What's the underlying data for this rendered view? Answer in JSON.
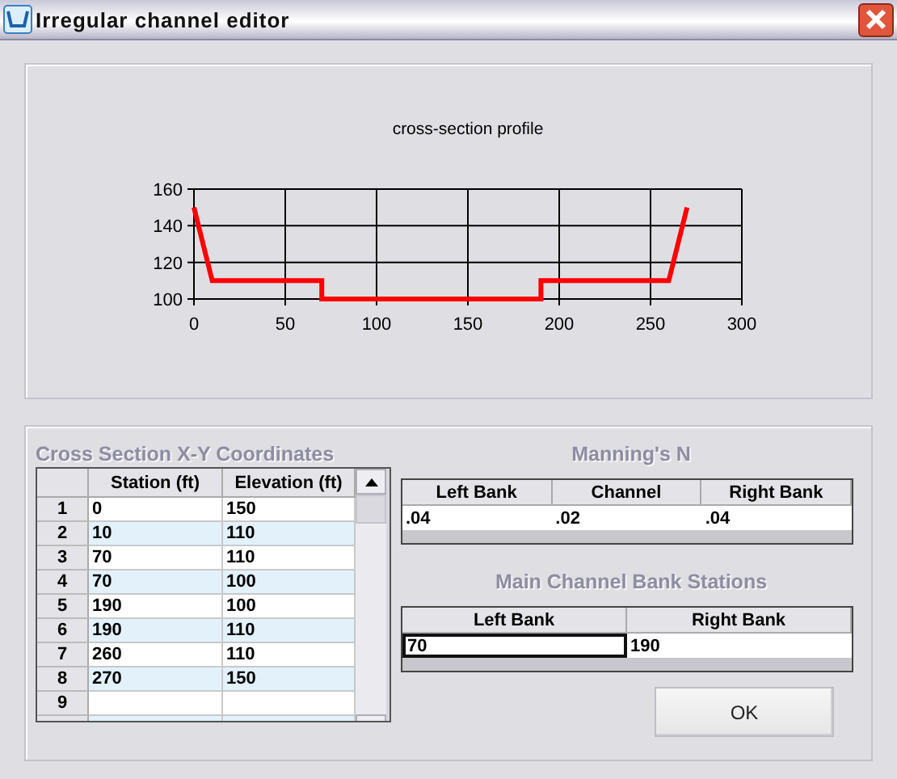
{
  "window": {
    "title": "Irregular channel editor"
  },
  "chart": {
    "chart_data": {
      "type": "line",
      "grid": true,
      "title": "cross-section profile",
      "x": [
        0,
        10,
        70,
        70,
        190,
        190,
        260,
        270
      ],
      "series": [
        {
          "color": "#ff0000",
          "values": [
            150,
            110,
            110,
            100,
            100,
            110,
            110,
            150
          ]
        }
      ],
      "xlim": [
        0,
        300
      ],
      "ylim": [
        100,
        160
      ],
      "xticks": [
        0,
        50,
        100,
        150,
        200,
        250,
        300
      ],
      "yticks": [
        100,
        120,
        140,
        160
      ]
    }
  },
  "coordinates": {
    "title": "Cross Section X-Y Coordinates",
    "columns": [
      "Station (ft)",
      "Elevation (ft)"
    ],
    "rows": [
      {
        "number": "1",
        "cells": [
          "0",
          "150"
        ]
      },
      {
        "number": "2",
        "cells": [
          "10",
          "110"
        ]
      },
      {
        "number": "3",
        "cells": [
          "70",
          "110"
        ]
      },
      {
        "number": "4",
        "cells": [
          "70",
          "100"
        ]
      },
      {
        "number": "5",
        "cells": [
          "190",
          "100"
        ]
      },
      {
        "number": "6",
        "cells": [
          "190",
          "110"
        ]
      },
      {
        "number": "7",
        "cells": [
          "260",
          "110"
        ]
      },
      {
        "number": "8",
        "cells": [
          "270",
          "150"
        ]
      },
      {
        "number": "9",
        "cells": []
      }
    ]
  },
  "mannings": {
    "title": "Manning's N",
    "fields": [
      {
        "label": "Left Bank",
        "value": ".04",
        "focused": false
      },
      {
        "label": "Channel",
        "value": ".02",
        "focused": false
      },
      {
        "label": "Right Bank",
        "value": ".04",
        "focused": false
      }
    ]
  },
  "bank_stations": {
    "title": "Main Channel Bank Stations",
    "fields": [
      {
        "label": "Left Bank",
        "value": "70",
        "focused": true
      },
      {
        "label": "Right Bank",
        "value": "190",
        "focused": false
      }
    ]
  },
  "buttons": [
    "OK"
  ]
}
